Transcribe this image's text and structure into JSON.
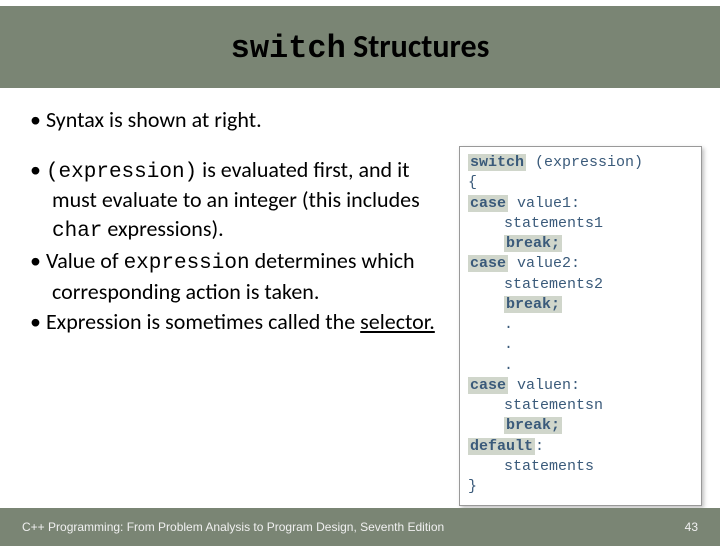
{
  "title": {
    "mono": "switch",
    "rest": " Structures"
  },
  "bullets": {
    "b1": "Syntax is shown at right.",
    "b2a": "(expression)",
    "b2b": " is evaluated first, and it must evaluate to an integer (this includes ",
    "b2c": "char",
    "b2d": " expressions).",
    "b3a": "Value of ",
    "b3b": "expression",
    "b3c": " determines which corresponding action is taken.",
    "b4a": "Expression is sometimes called the ",
    "b4b": "selector."
  },
  "code": {
    "l1a": "switch",
    "l1b": " (expression)",
    "l2": "{",
    "l3a": "case",
    "l3b": " value1:",
    "l4": "    statements1",
    "l5a": "    ",
    "l5b": "break;",
    "l6a": "case",
    "l6b": " value2:",
    "l7": "    statements2",
    "l8a": "    ",
    "l8b": "break;",
    "l9": "    .",
    "l10": "    .",
    "l11": "    .",
    "l12a": "case",
    "l12b": " valuen:",
    "l13": "    statementsn",
    "l14a": "    ",
    "l14b": "break;",
    "l15a": "default",
    "l15b": ":",
    "l16": "    statements",
    "l17": "}"
  },
  "footer": {
    "left": "C++ Programming: From Problem Analysis to Program Design, Seventh Edition",
    "right": "43"
  }
}
